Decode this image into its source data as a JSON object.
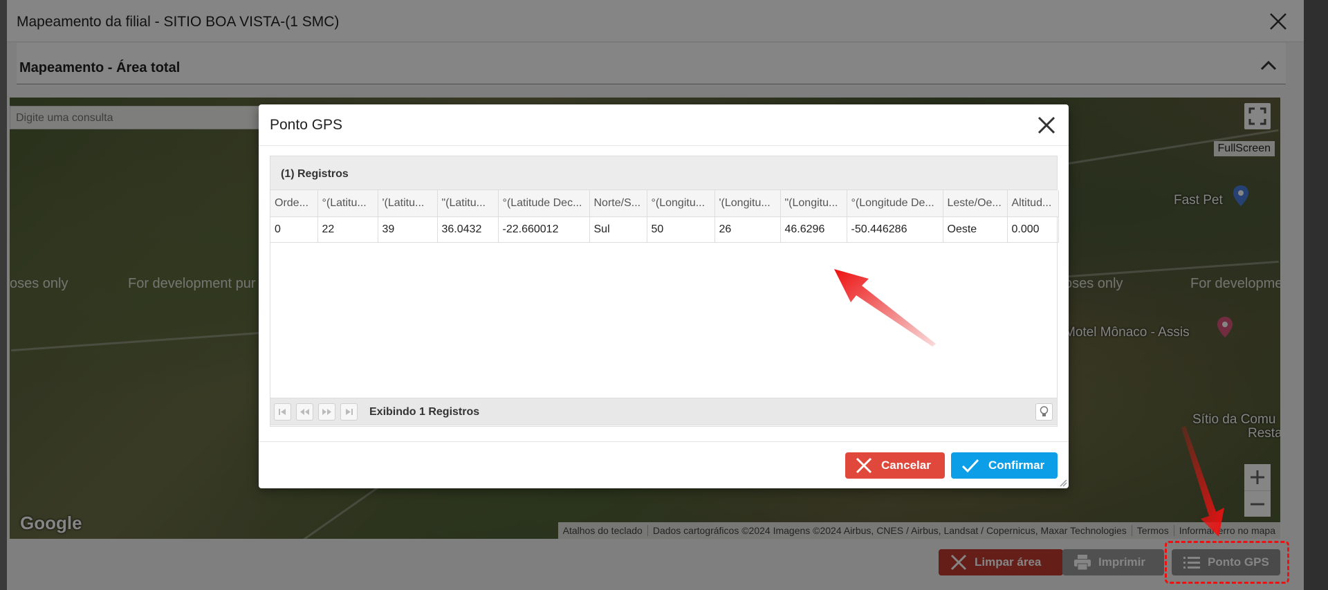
{
  "window": {
    "title": "Mapeamento da filial - SITIO BOA VISTA-(1 SMC)"
  },
  "section": {
    "title": "Mapeamento - Área total"
  },
  "map": {
    "search_placeholder": "Digite uma consulta",
    "watermark_left_1": "oses only",
    "watermark_left_2": "For development pur",
    "watermark_right_1": "oses only",
    "watermark_right_2": "For developme",
    "place_fast_pet": "Fast Pet",
    "place_motel": "Motel Mônaco - Assis",
    "place_sitio": "Sítio da Comu",
    "place_sitio2": "Resta",
    "fullscreen_label": "FullScreen",
    "google": "Google",
    "attribution": {
      "shortcuts": "Atalhos do teclado",
      "data": "Dados cartográficos ©2024 Imagens ©2024 Airbus, CNES / Airbus, Landsat / Copernicus, Maxar Technologies",
      "terms": "Termos",
      "report": "Informar erro no mapa"
    }
  },
  "footer": {
    "limpar_label": "Limpar área",
    "imprimir_label": "Imprimir",
    "gps_label": "Ponto GPS"
  },
  "modal": {
    "title": "Ponto GPS",
    "grid_caption": "(1) Registros",
    "columns": [
      "Orde...",
      "°(Latitu...",
      "'(Latitu...",
      "\"(Latitu...",
      "°(Latitude Dec...",
      "Norte/S...",
      "°(Longitu...",
      "'(Longitu...",
      "\"(Longitu...",
      "°(Longitude De...",
      "Leste/Oe...",
      "Altitud..."
    ],
    "rows": [
      [
        "0",
        "22",
        "39",
        "36.0432",
        "-22.660012",
        "Sul",
        "50",
        "26",
        "46.6296",
        "-50.446286",
        "Oeste",
        "0.000"
      ]
    ],
    "pager_text": "Exibindo 1 Registros",
    "cancel_label": "Cancelar",
    "confirm_label": "Confirmar"
  },
  "colors": {
    "danger": "#e0483b",
    "primary": "#0d9ee8",
    "annotation": "#e11"
  }
}
